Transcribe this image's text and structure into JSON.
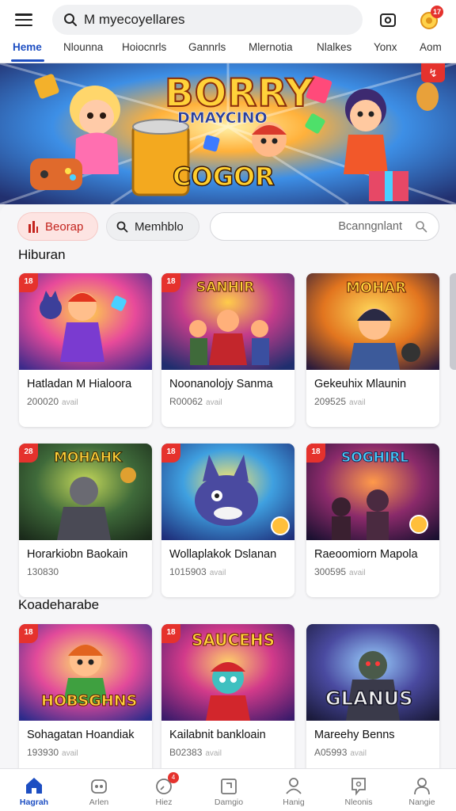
{
  "search": {
    "query": "M myecoyellares"
  },
  "tabs": [
    "Heme",
    "Nlounna",
    "Hoiocnrls",
    "Gannrls",
    "Mlernotia",
    "Nlalkes",
    "Yonx",
    "Aom"
  ],
  "notifications": {
    "count": "17"
  },
  "banner": {
    "title": "BORRY",
    "subtitle": "DMAYCINO",
    "footer": "COGOR",
    "promo_icon": "flame-icon"
  },
  "filters": {
    "chip_primary": "Beorap",
    "chip_secondary": "Memhblo",
    "input_value": "Bcanngnlant"
  },
  "sections": [
    {
      "title": "Hiburan",
      "games": [
        {
          "name": "Hatladan M Hialoora",
          "plays": "200020",
          "sub": "avail",
          "badge": "18"
        },
        {
          "name": "Noonanolojy Sanma",
          "plays": "R00062",
          "sub": "avail",
          "badge": "18"
        },
        {
          "name": "Gekeuhix Mlaunin",
          "plays": "209525",
          "sub": "avail",
          "badge": ""
        }
      ]
    },
    {
      "title": "",
      "games": [
        {
          "name": "Horarkiobn Baokain",
          "plays": "130830",
          "sub": "",
          "badge": "28"
        },
        {
          "name": "Wollaplakok Dslanan",
          "plays": "1015903",
          "sub": "avail",
          "badge": "18"
        },
        {
          "name": "Raeoomiorn Mapola",
          "plays": "300595",
          "sub": "avail",
          "badge": "18"
        }
      ]
    },
    {
      "title": "Koadeharabe",
      "games": [
        {
          "name": "Sohagatan Hoandiak",
          "plays": "193930",
          "sub": "avail",
          "badge": "18"
        },
        {
          "name": "Kailabnit bankloain",
          "plays": "B02383",
          "sub": "avail",
          "badge": "18"
        },
        {
          "name": "Mareehy Benns",
          "plays": "A05993",
          "sub": "avail",
          "badge": ""
        }
      ]
    }
  ],
  "thumb_titles": {
    "s0g1": "SANHIR",
    "s0g2": "MOHAR",
    "s1g0": "MOHAHK",
    "s1g2": "SOGHIRL",
    "s2g0": "HOBSGHNS",
    "s2g1": "SAUCEHS",
    "s2g2": "GLANUS"
  },
  "bottom_nav": [
    {
      "label": "Hagrah",
      "icon": "home-icon",
      "active": true
    },
    {
      "label": "Arlen",
      "icon": "gamepad-icon",
      "active": false
    },
    {
      "label": "Hiez",
      "icon": "clock-icon",
      "active": false,
      "badge": "4"
    },
    {
      "label": "Damgio",
      "icon": "gift-icon",
      "active": false
    },
    {
      "label": "Hanig",
      "icon": "people-icon",
      "active": false
    },
    {
      "label": "Nleonis",
      "icon": "message-icon",
      "active": false
    },
    {
      "label": "Nangie",
      "icon": "user-icon",
      "active": false
    }
  ],
  "colors": {
    "accent": "#1d4ec2",
    "badge": "#e5322d",
    "chip_red_bg": "#fde4e2"
  }
}
